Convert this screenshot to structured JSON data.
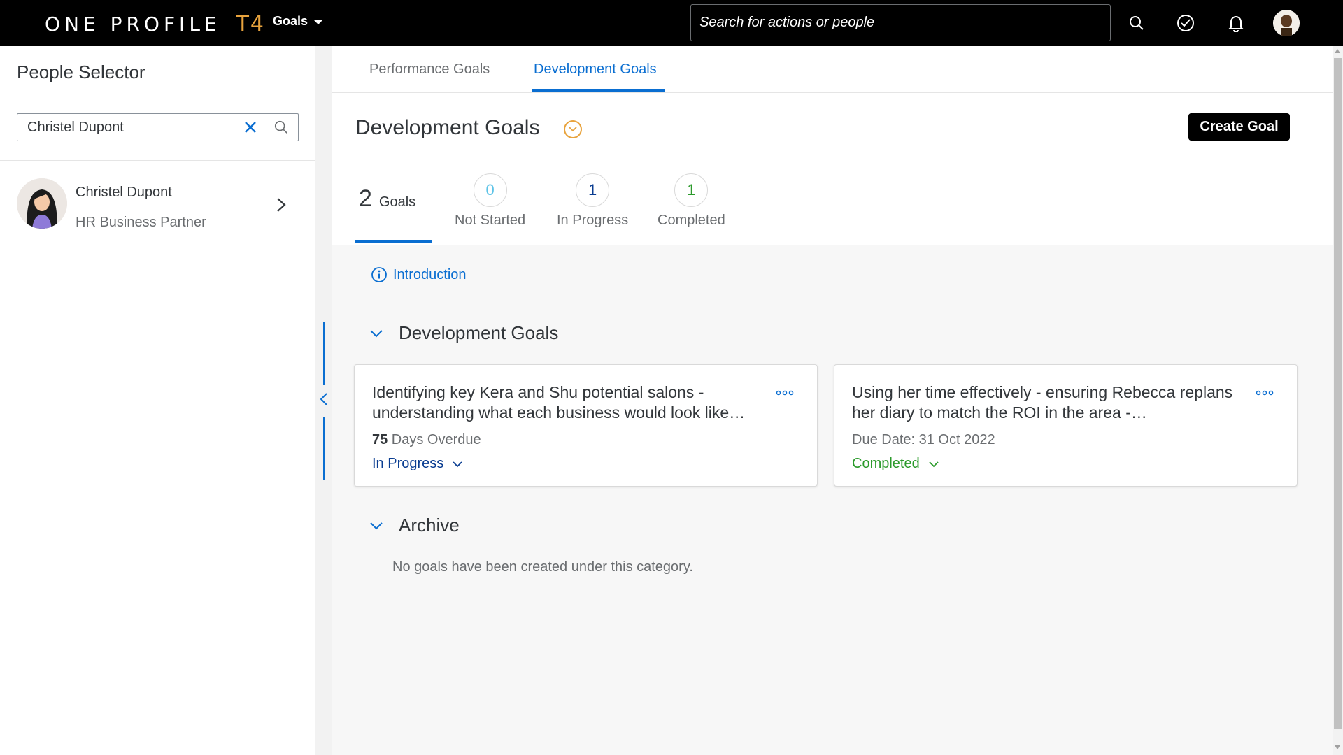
{
  "app": {
    "logo_main": "ONE PROFILE",
    "logo_suffix": "T4",
    "menu_label": "Goals",
    "search_placeholder": "Search for actions or people",
    "accent_color": "#0a6ed1",
    "brand_color": "#e8a33d"
  },
  "people_selector": {
    "title": "People Selector",
    "search_value": "Christel Dupont",
    "person": {
      "name": "Christel Dupont",
      "role": "HR Business Partner"
    }
  },
  "tabs": [
    {
      "label": "Performance Goals",
      "active": false
    },
    {
      "label": "Development Goals",
      "active": true
    }
  ],
  "header": {
    "title": "Development Goals",
    "create_button": "Create Goal"
  },
  "stats": {
    "total_count": "2",
    "total_label": "Goals",
    "not_started": {
      "count": "0",
      "label": "Not Started",
      "color": "#5dc3e7"
    },
    "in_progress": {
      "count": "1",
      "label": "In Progress",
      "color": "#0a3d91"
    },
    "completed": {
      "count": "1",
      "label": "Completed",
      "color": "#2b9a2b"
    }
  },
  "content": {
    "intro_label": "Introduction",
    "section_development": "Development Goals",
    "section_archive": "Archive",
    "archive_empty": "No goals have been created under this category."
  },
  "goals": [
    {
      "title": "Identifying key Kera and Shu potential salons - understanding what each business would look like…",
      "meta_strong": "75",
      "meta_text": " Days Overdue",
      "status": "In Progress",
      "status_color": "#0a3d91"
    },
    {
      "title": "Using her time effectively - ensuring Rebecca replans her diary to match the ROI in the area -…",
      "meta_strong": "",
      "meta_text": "Due Date: 31 Oct 2022",
      "status": "Completed",
      "status_color": "#2b9a2b"
    }
  ]
}
